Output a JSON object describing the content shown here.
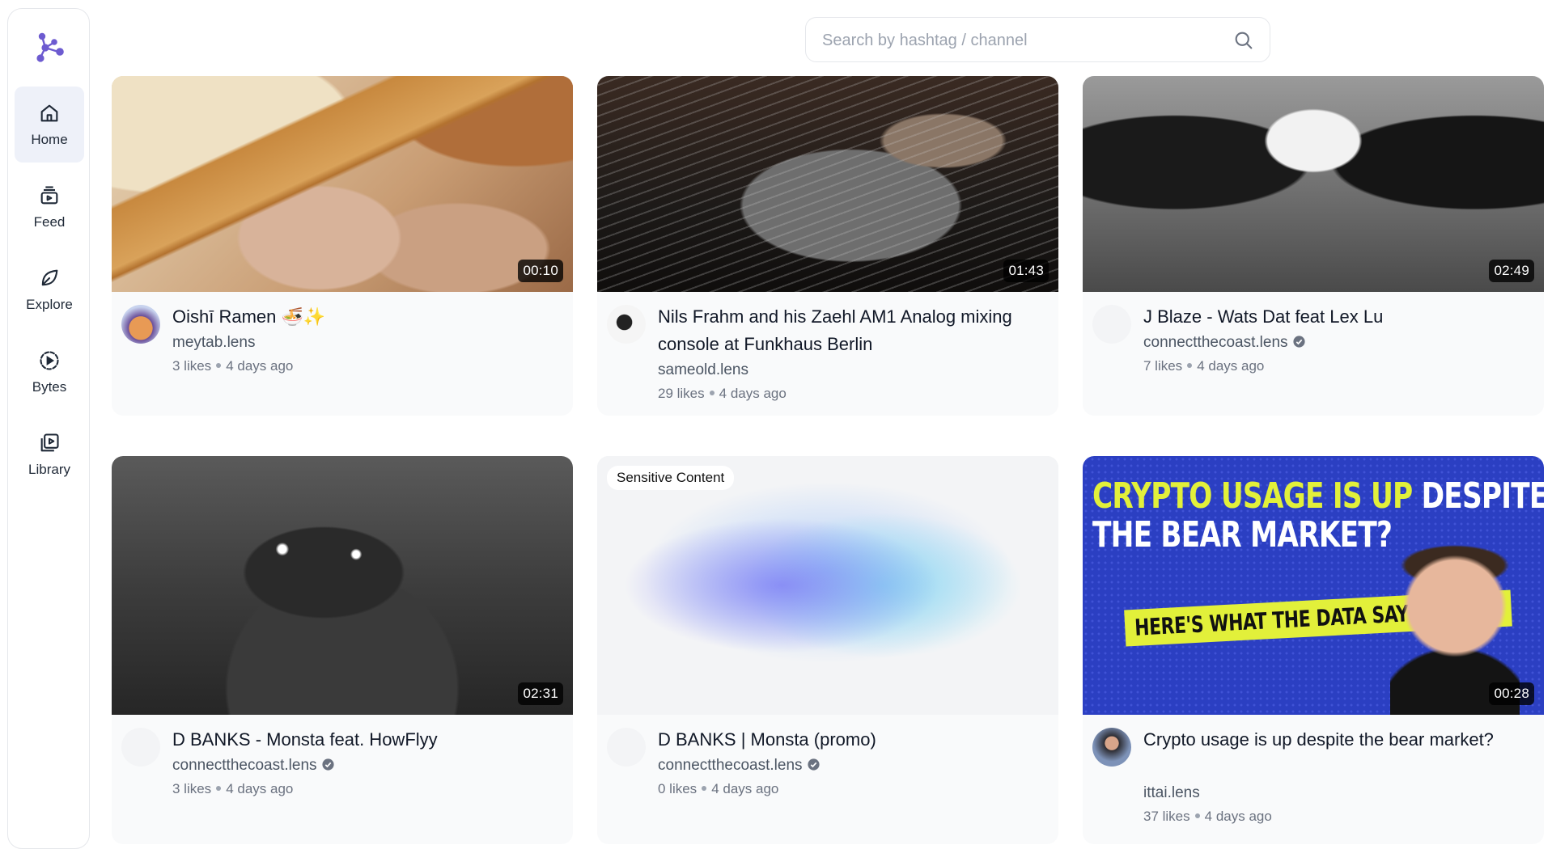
{
  "sidebar": {
    "items": [
      {
        "label": "Home",
        "icon": "home-icon",
        "active": true
      },
      {
        "label": "Feed",
        "icon": "feed-icon",
        "active": false
      },
      {
        "label": "Explore",
        "icon": "leaf-icon",
        "active": false
      },
      {
        "label": "Bytes",
        "icon": "bytes-icon",
        "active": false
      },
      {
        "label": "Library",
        "icon": "library-icon",
        "active": false
      }
    ]
  },
  "search": {
    "placeholder": "Search by hashtag / channel",
    "value": ""
  },
  "videos": [
    {
      "title": "Oishī Ramen 🍜✨",
      "channel": "meytab.lens",
      "verified": false,
      "likes": "3 likes",
      "age": "4 days ago",
      "duration": "00:10"
    },
    {
      "title": "Nils Frahm and his Zaehl AM1 Analog mixing console at Funkhaus Berlin",
      "channel": "sameold.lens",
      "verified": false,
      "likes": "29 likes",
      "age": "4 days ago",
      "duration": "01:43"
    },
    {
      "title": "J Blaze - Wats Dat feat Lex Lu",
      "channel": "connectthecoast.lens",
      "verified": true,
      "likes": "7 likes",
      "age": "4 days ago",
      "duration": "02:49"
    },
    {
      "title": "D BANKS - Monsta feat. HowFlyy",
      "channel": "connectthecoast.lens",
      "verified": true,
      "likes": "3 likes",
      "age": "4 days ago",
      "duration": "02:31"
    },
    {
      "title": "D BANKS | Monsta (promo)",
      "channel": "connectthecoast.lens",
      "verified": true,
      "likes": "0 likes",
      "age": "4 days ago",
      "badge": "Sensitive Content"
    },
    {
      "title": "Crypto usage is up despite the bear market?",
      "channel": "ittai.lens",
      "verified": false,
      "likes": "37 likes",
      "age": "4 days ago",
      "duration": "00:28",
      "thumb_text": {
        "line1a": "CRYPTO USAGE IS UP",
        "line1b": "DESPITE",
        "line2": "THE BEAR MARKET?",
        "banner": "HERE'S WHAT THE DATA SAYS"
      }
    }
  ],
  "colors": {
    "accent": "#6d5bd0",
    "card_bg": "#f9fafb",
    "active_nav": "#eef1f9",
    "crypto_yellow": "#e2f03a",
    "crypto_blue": "#2b3fc2"
  }
}
